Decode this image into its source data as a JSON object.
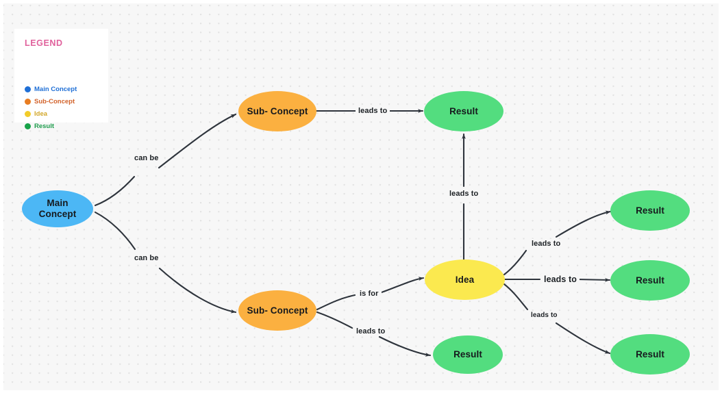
{
  "canvas": {
    "background": "#f7f7f7",
    "dot_color": "#e2e2e2"
  },
  "legend": {
    "title": "LEGEND",
    "items": [
      {
        "label": "Main Concept",
        "color": "#1f6fd6",
        "dot_color": "#1f6fd6"
      },
      {
        "label": "Sub-Concept",
        "color": "#d2622a",
        "dot_color": "#e87d22"
      },
      {
        "label": "Idea",
        "color": "#d2a72a",
        "dot_color": "#f2cc2a"
      },
      {
        "label": "Result",
        "color": "#1f9d4d",
        "dot_color": "#18a349"
      }
    ]
  },
  "nodes": [
    {
      "id": "main",
      "label": "Main\nConcept",
      "type": "main",
      "fill": "#4cb7f5"
    },
    {
      "id": "sub1",
      "label": "Sub- Concept",
      "type": "sub",
      "fill": "#fbb040"
    },
    {
      "id": "sub2",
      "label": "Sub- Concept",
      "type": "sub",
      "fill": "#fbb040"
    },
    {
      "id": "idea",
      "label": "Idea",
      "type": "idea",
      "fill": "#fbe94f"
    },
    {
      "id": "result1",
      "label": "Result",
      "type": "result",
      "fill": "#53dd7f"
    },
    {
      "id": "result2",
      "label": "Result",
      "type": "result",
      "fill": "#53dd7f"
    },
    {
      "id": "result3",
      "label": "Result",
      "type": "result",
      "fill": "#53dd7f"
    },
    {
      "id": "result4",
      "label": "Result",
      "type": "result",
      "fill": "#53dd7f"
    },
    {
      "id": "result5",
      "label": "Result",
      "type": "result",
      "fill": "#53dd7f"
    }
  ],
  "edges": [
    {
      "from": "main",
      "to": "sub1",
      "label": "can be"
    },
    {
      "from": "main",
      "to": "sub2",
      "label": "can be"
    },
    {
      "from": "sub1",
      "to": "result1",
      "label": "leads to"
    },
    {
      "from": "sub2",
      "to": "idea",
      "label": "is for"
    },
    {
      "from": "sub2",
      "to": "result5",
      "label": "leads to"
    },
    {
      "from": "idea",
      "to": "result1",
      "label": "leads to"
    },
    {
      "from": "idea",
      "to": "result2",
      "label": "leads to"
    },
    {
      "from": "idea",
      "to": "result3",
      "label": "leads to"
    },
    {
      "from": "idea",
      "to": "result4",
      "label": "leads to"
    }
  ],
  "edge_labels": {
    "can_be_top": "can be",
    "can_be_bottom": "can be",
    "sub1_to_result": "leads to",
    "idea_to_result_top": "leads to",
    "idea_up": "leads to",
    "is_for": "is for",
    "sub2_leads_to": "leads to",
    "idea_mid": "leads to",
    "idea_low": "leads to"
  }
}
